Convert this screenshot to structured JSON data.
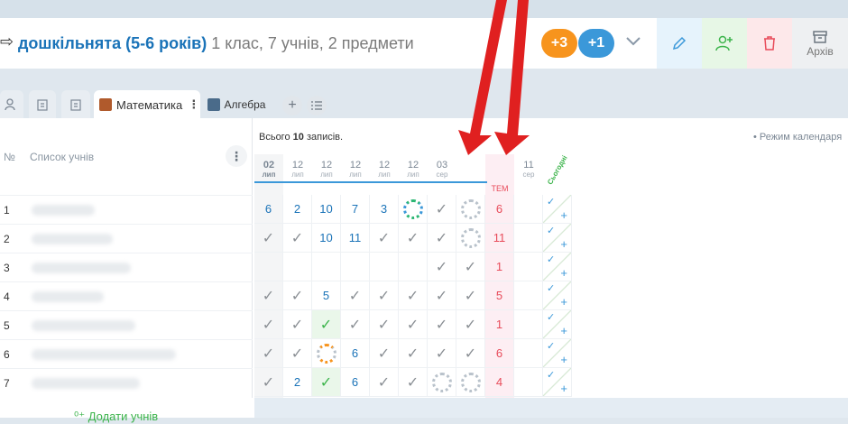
{
  "header": {
    "back_icon": "arrow-right-icon",
    "group_name": "дошкільнята (5-6 років)",
    "group_details": "1 клас, 7 учнів, 2 предмети",
    "badge_orange": "+3",
    "badge_blue": "+1",
    "archive_label": "Архів"
  },
  "tabs": {
    "subject_1": "Математика",
    "subject_2": "Алгебра"
  },
  "list": {
    "number_header": "№",
    "students_header": "Список учнів",
    "add_students": "Додати учнів",
    "rows": [
      "1",
      "2",
      "3",
      "4",
      "5",
      "6",
      "7"
    ]
  },
  "journal": {
    "total_prefix": "Всього",
    "total_count": "10",
    "total_suffix": "записів.",
    "calendar_mode": "• Режим календаря",
    "today_label": "Сьогодні",
    "topic_label": "ТЕМ",
    "dates": [
      {
        "d": "02",
        "m": "лип"
      },
      {
        "d": "12",
        "m": "лип"
      },
      {
        "d": "12",
        "m": "лип"
      },
      {
        "d": "12",
        "m": "лип"
      },
      {
        "d": "12",
        "m": "лип"
      },
      {
        "d": "12",
        "m": "лип"
      },
      {
        "d": "03",
        "m": "сер"
      },
      {
        "d": "",
        "m": ""
      },
      {
        "d": "",
        "m": ""
      },
      {
        "d": "11",
        "m": "сер"
      }
    ],
    "rows": [
      [
        "6",
        "2",
        "10",
        "7",
        "3",
        "ring-green",
        "check",
        "ring",
        "6",
        "",
        "today"
      ],
      [
        "check",
        "check",
        "10",
        "11",
        "check",
        "check",
        "check",
        "ring",
        "11",
        "",
        "today"
      ],
      [
        "",
        "",
        "",
        "",
        "",
        "",
        "check",
        "check",
        "1",
        "",
        "today"
      ],
      [
        "check",
        "check",
        "5",
        "check",
        "check",
        "check",
        "check",
        "check",
        "5",
        "",
        "today"
      ],
      [
        "check",
        "check",
        "check-green",
        "check",
        "check",
        "check",
        "check",
        "check",
        "1",
        "",
        "today"
      ],
      [
        "check",
        "check",
        "ring-orange",
        "6",
        "check",
        "check",
        "check",
        "check",
        "6",
        "",
        "today"
      ],
      [
        "check",
        "2",
        "check-green",
        "6",
        "check",
        "check",
        "ring",
        "ring",
        "4",
        "",
        "today"
      ]
    ]
  },
  "colors": {
    "accent_blue": "#1a73b8",
    "orange": "#f7941d",
    "blue_badge": "#3b98d9",
    "green": "#3cb44b",
    "red": "#e84b5a",
    "arrow_red": "#e02020"
  }
}
